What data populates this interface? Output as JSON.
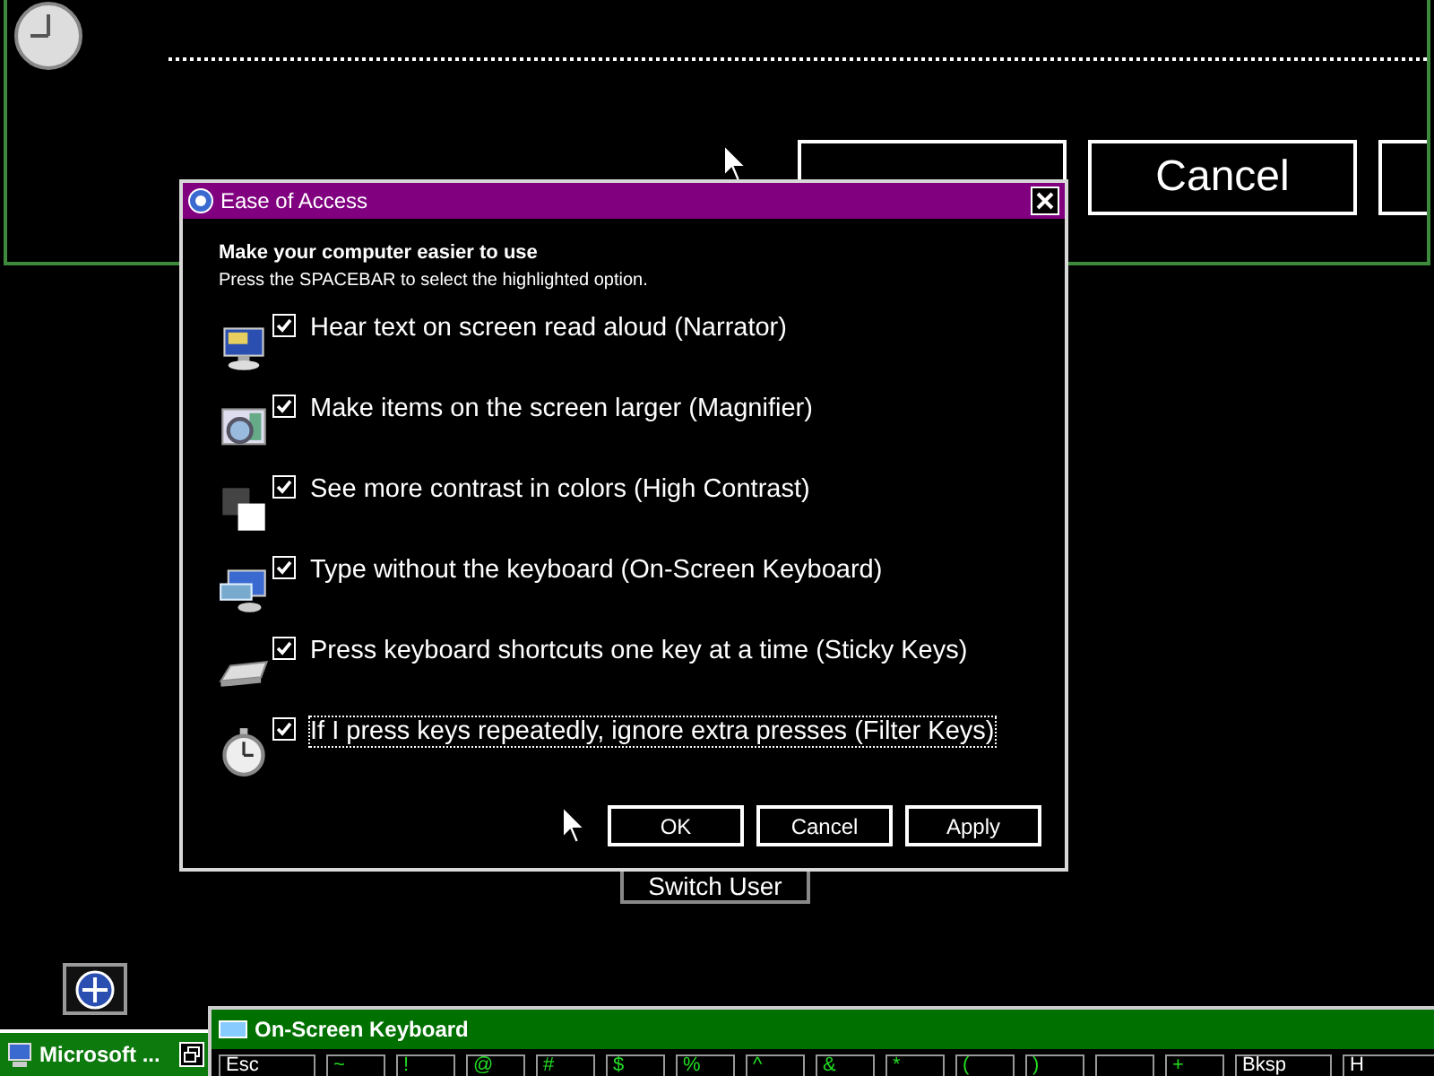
{
  "background_window": {
    "buttons": [
      {
        "kind": "cut"
      },
      {
        "label": "Cancel",
        "kind": "text"
      },
      {
        "kind": "cut"
      }
    ]
  },
  "dialog": {
    "title": "Ease of Access",
    "heading": "Make your computer easier to use",
    "instruction": "Press the SPACEBAR to select the highlighted option.",
    "options": [
      {
        "label": "Hear text on screen read aloud (Narrator)",
        "checked": true,
        "focused": false
      },
      {
        "label": "Make items on the screen larger (Magnifier)",
        "checked": true,
        "focused": false
      },
      {
        "label": "See more contrast in colors (High Contrast)",
        "checked": true,
        "focused": false
      },
      {
        "label": "Type without the keyboard (On-Screen Keyboard)",
        "checked": true,
        "focused": false
      },
      {
        "label": "Press keyboard shortcuts one key at a time (Sticky Keys)",
        "checked": true,
        "focused": false
      },
      {
        "label": "If I press keys repeatedly, ignore extra presses (Filter Keys)",
        "checked": true,
        "focused": true
      }
    ],
    "buttons": [
      "OK",
      "Cancel",
      "Apply"
    ]
  },
  "switch_user_button": "Switch User",
  "taskbar": {
    "item": "Microsoft ..."
  },
  "osk": {
    "title": "On-Screen Keyboard",
    "keys": [
      {
        "label": "Esc",
        "kind": "control"
      },
      {
        "label": "~",
        "kind": "symbol"
      },
      {
        "label": "!",
        "kind": "symbol"
      },
      {
        "label": "@",
        "kind": "symbol"
      },
      {
        "label": "#",
        "kind": "symbol"
      },
      {
        "label": "$",
        "kind": "symbol"
      },
      {
        "label": "%",
        "kind": "symbol"
      },
      {
        "label": "^",
        "kind": "symbol"
      },
      {
        "label": "&",
        "kind": "symbol"
      },
      {
        "label": "*",
        "kind": "symbol"
      },
      {
        "label": "(",
        "kind": "symbol"
      },
      {
        "label": ")",
        "kind": "symbol"
      },
      {
        "kind": "blank"
      },
      {
        "label": "+",
        "kind": "symbol"
      },
      {
        "label": "Bksp",
        "kind": "control"
      },
      {
        "label": "H",
        "kind": "control"
      }
    ]
  }
}
